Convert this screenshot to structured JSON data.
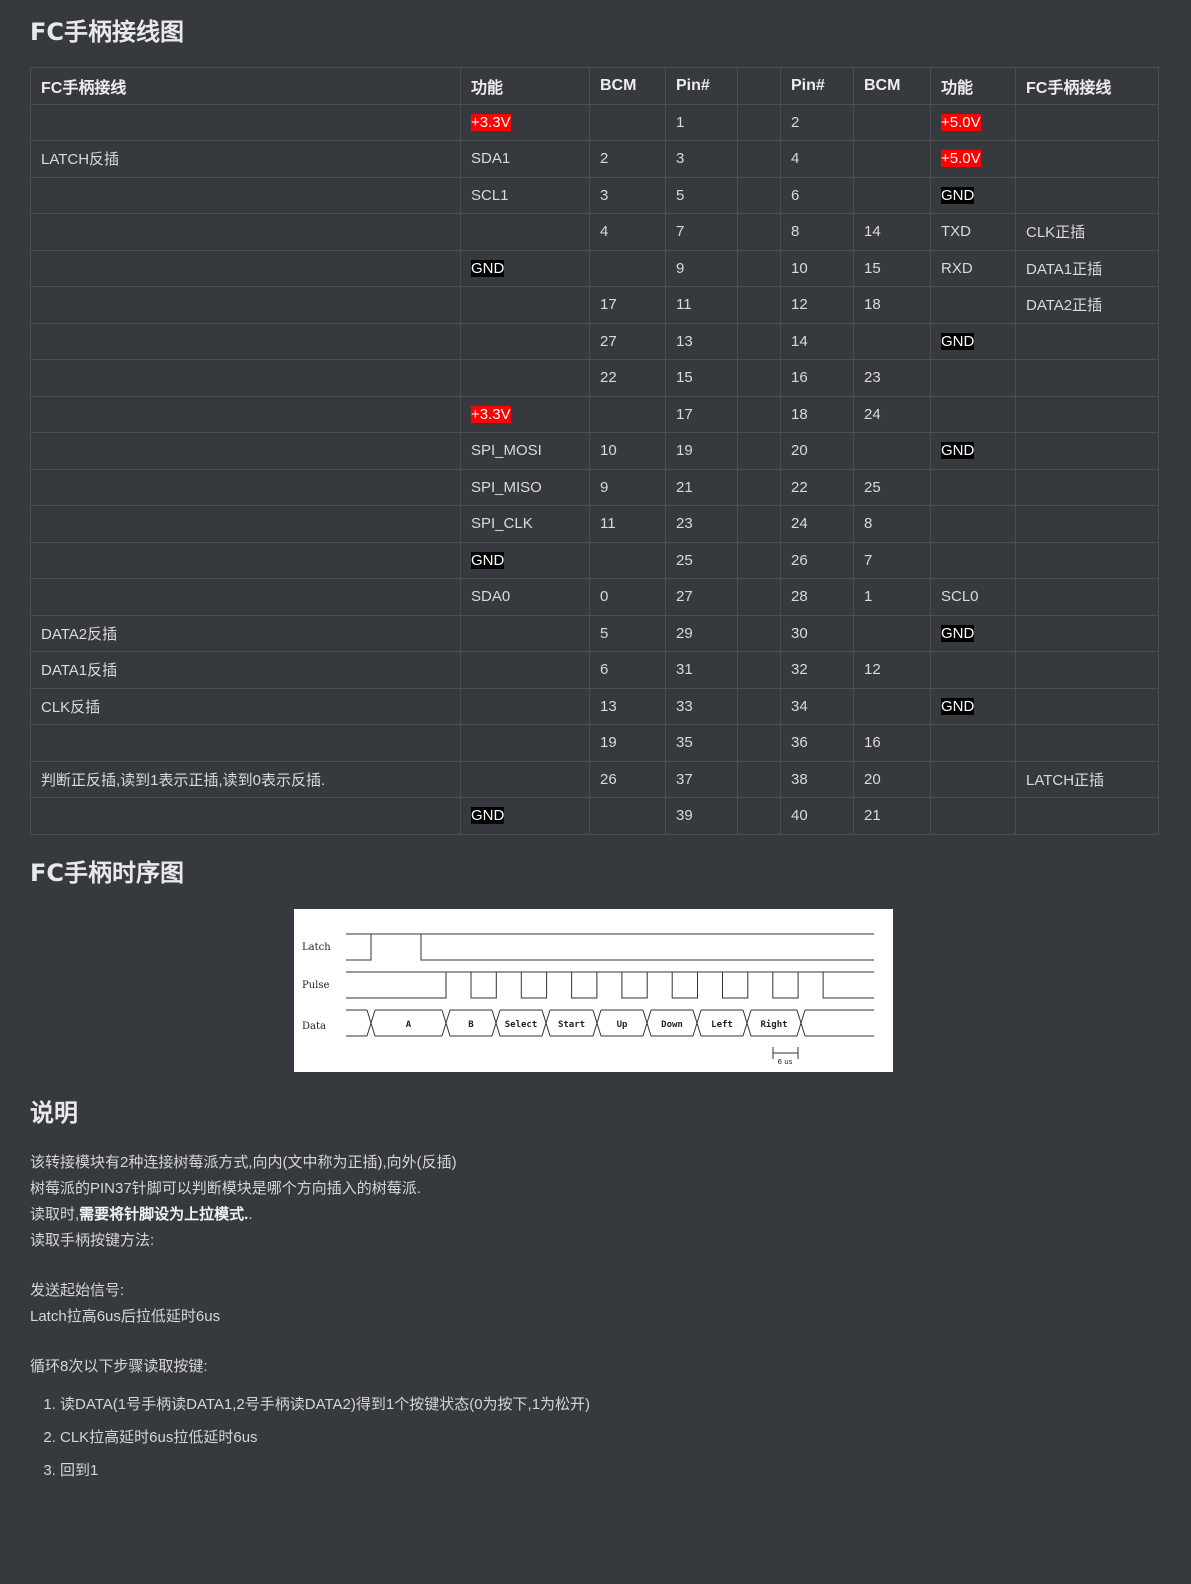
{
  "headings": {
    "wiring": "FC手柄接线图",
    "timing": "FC手柄时序图",
    "notes": "说明"
  },
  "table": {
    "headers": [
      "FC手柄接线",
      "功能",
      "BCM",
      "Pin#",
      "",
      "Pin#",
      "BCM",
      "功能",
      "FC手柄接线"
    ],
    "rows": [
      [
        "",
        "+3.3V",
        "",
        "1",
        "",
        "2",
        "",
        "+5.0V",
        ""
      ],
      [
        "LATCH反插",
        "SDA1",
        "2",
        "3",
        "",
        "4",
        "",
        "+5.0V",
        ""
      ],
      [
        "",
        "SCL1",
        "3",
        "5",
        "",
        "6",
        "",
        "GND",
        ""
      ],
      [
        "",
        "",
        "4",
        "7",
        "",
        "8",
        "14",
        "TXD",
        "CLK正插"
      ],
      [
        "",
        "GND",
        "",
        "9",
        "",
        "10",
        "15",
        "RXD",
        "DATA1正插"
      ],
      [
        "",
        "",
        "17",
        "11",
        "",
        "12",
        "18",
        "",
        "DATA2正插"
      ],
      [
        "",
        "",
        "27",
        "13",
        "",
        "14",
        "",
        "GND",
        ""
      ],
      [
        "",
        "",
        "22",
        "15",
        "",
        "16",
        "23",
        "",
        ""
      ],
      [
        "",
        "+3.3V",
        "",
        "17",
        "",
        "18",
        "24",
        "",
        ""
      ],
      [
        "",
        "SPI_MOSI",
        "10",
        "19",
        "",
        "20",
        "",
        "GND",
        ""
      ],
      [
        "",
        "SPI_MISO",
        "9",
        "21",
        "",
        "22",
        "25",
        "",
        ""
      ],
      [
        "",
        "SPI_CLK",
        "11",
        "23",
        "",
        "24",
        "8",
        "",
        ""
      ],
      [
        "",
        "GND",
        "",
        "25",
        "",
        "26",
        "7",
        "",
        ""
      ],
      [
        "",
        "SDA0",
        "0",
        "27",
        "",
        "28",
        "1",
        "SCL0",
        ""
      ],
      [
        "DATA2反插",
        "",
        "5",
        "29",
        "",
        "30",
        "",
        "GND",
        ""
      ],
      [
        "DATA1反插",
        "",
        "6",
        "31",
        "",
        "32",
        "12",
        "",
        ""
      ],
      [
        "CLK反插",
        "",
        "13",
        "33",
        "",
        "34",
        "",
        "GND",
        ""
      ],
      [
        "",
        "",
        "19",
        "35",
        "",
        "36",
        "16",
        "",
        ""
      ],
      [
        "判断正反插,读到1表示正插,读到0表示反插.",
        "",
        "26",
        "37",
        "",
        "38",
        "20",
        "",
        "LATCH正插"
      ],
      [
        "",
        "GND",
        "",
        "39",
        "",
        "40",
        "21",
        "",
        ""
      ]
    ],
    "highlight_colors": {
      "power": "#ff0000",
      "ground": "#000000"
    }
  },
  "timing_diagram": {
    "signals": [
      "Latch",
      "Pulse",
      "Data"
    ],
    "data_bits": [
      "A",
      "B",
      "Select",
      "Start",
      "Up",
      "Down",
      "Left",
      "Right"
    ],
    "interval_label": "6 us"
  },
  "notes": {
    "line1": "该转接模块有2种连接树莓派方式,向内(文中称为正插),向外(反插)",
    "line2": "树莓派的PIN37针脚可以判断模块是哪个方向插入的树莓派.",
    "line3_prefix": "读取时,",
    "line3_bold": "需要将针脚设为上拉模式.",
    "line3_suffix": ".",
    "line4": "读取手柄按键方法:",
    "line5": "发送起始信号:",
    "line6": "Latch拉高6us后拉低延时6us",
    "line7": "循环8次以下步骤读取按键:",
    "steps": [
      "读DATA(1号手柄读DATA1,2号手柄读DATA2)得到1个按键状态(0为按下,1为松开)",
      "CLK拉高延时6us拉低延时6us",
      "回到1"
    ]
  }
}
